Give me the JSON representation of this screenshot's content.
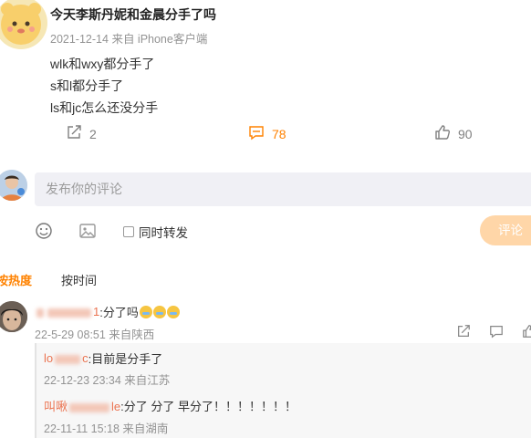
{
  "post": {
    "author": "今天李斯丹妮和金晨分手了吗",
    "date": "2021-12-14",
    "source": "来自 iPhone客户端",
    "lines": [
      "wlk和wxy都分手了",
      "s和l都分手了",
      "ls和jc怎么还没分手"
    ],
    "stats": {
      "share": "2",
      "comment": "78",
      "like": "90"
    }
  },
  "composer": {
    "placeholder": "发布你的评论",
    "repost_label": "同时转发",
    "submit_label": "评论"
  },
  "sort_tabs": {
    "hot": "按热度",
    "time": "按时间"
  },
  "comment": {
    "user_suffix": "1",
    "text": ":分了吗",
    "meta": "22-5-29 08:51 来自陕西"
  },
  "replies": [
    {
      "user_prefix": "lo",
      "user_suffix": "c",
      "text": ":目前是分手了",
      "meta": "22-12-23 23:34 来自江苏"
    },
    {
      "user_prefix": "叫啾",
      "user_suffix": "le",
      "text": ":分了 分了 早分了！！！！！！！",
      "meta": "22-11-11 15:18 来自湖南"
    }
  ],
  "colors": {
    "accent": "#ff8200",
    "username": "#eb7350",
    "meta": "#939393",
    "submit_bg": "#ffd6a8"
  }
}
